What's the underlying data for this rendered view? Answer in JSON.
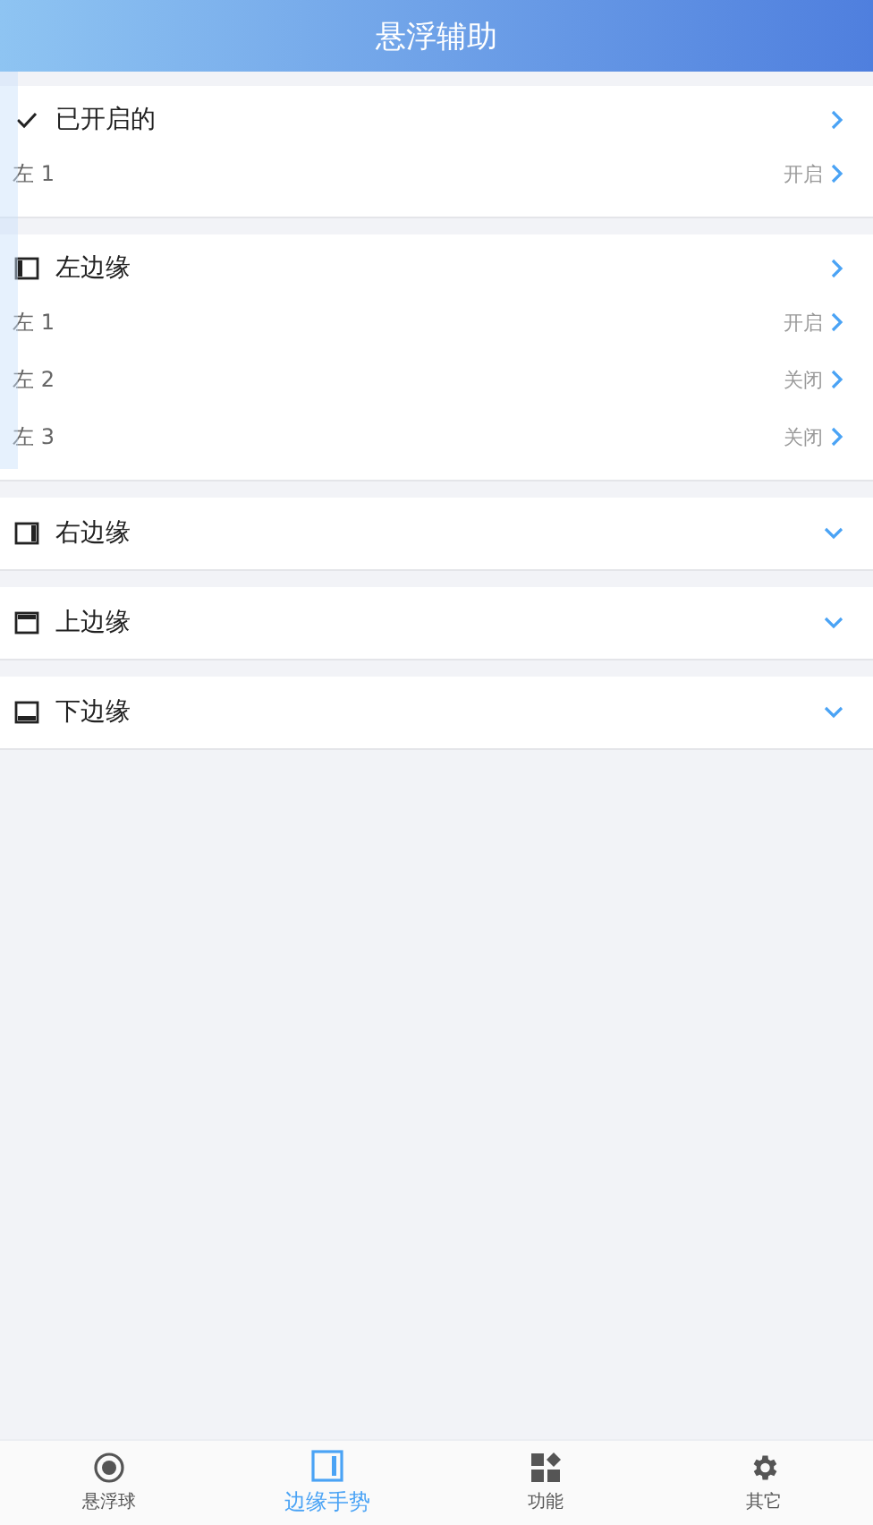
{
  "title": "悬浮辅助",
  "sections": [
    {
      "kind": "enabled",
      "label": "已开启的",
      "expanded": true,
      "items": [
        {
          "label": "左 1",
          "status": "开启"
        }
      ]
    },
    {
      "kind": "left",
      "label": "左边缘",
      "expanded": true,
      "items": [
        {
          "label": "左 1",
          "status": "开启"
        },
        {
          "label": "左 2",
          "status": "关闭"
        },
        {
          "label": "左 3",
          "status": "关闭"
        }
      ]
    },
    {
      "kind": "right",
      "label": "右边缘",
      "expanded": false
    },
    {
      "kind": "top",
      "label": "上边缘",
      "expanded": false
    },
    {
      "kind": "bottom",
      "label": "下边缘",
      "expanded": false
    }
  ],
  "tabs": [
    {
      "kind": "ball",
      "label": "悬浮球",
      "selected": false
    },
    {
      "kind": "edge",
      "label": "边缘手势",
      "selected": true
    },
    {
      "kind": "functions",
      "label": "功能",
      "selected": false
    },
    {
      "kind": "other",
      "label": "其它",
      "selected": false
    }
  ]
}
